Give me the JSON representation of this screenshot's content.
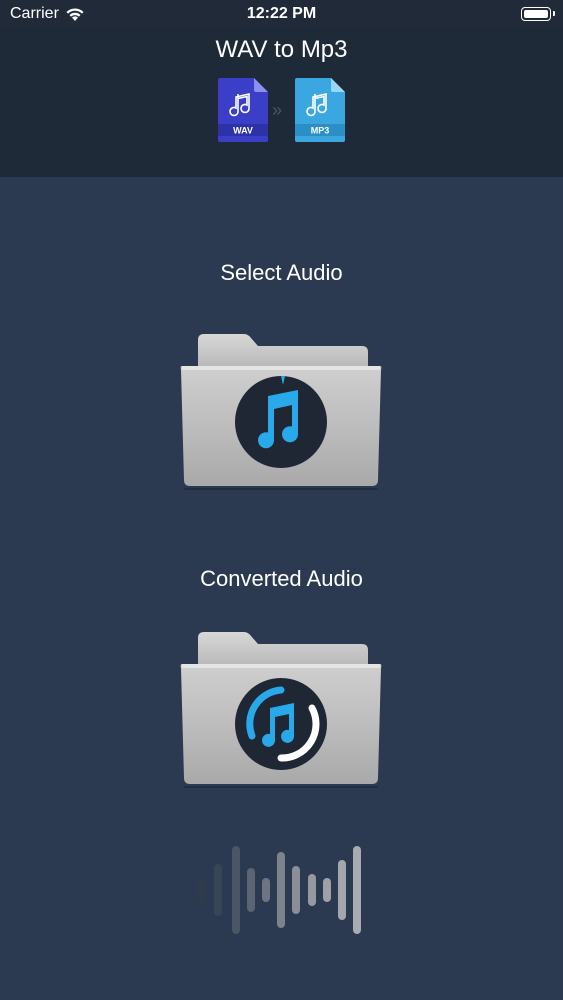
{
  "status_bar": {
    "carrier": "Carrier",
    "time": "12:22 PM"
  },
  "header": {
    "title": "WAV to Mp3",
    "source_format": "WAV",
    "target_format": "MP3"
  },
  "sections": {
    "select_audio": "Select Audio",
    "converted_audio": "Converted Audio"
  },
  "colors": {
    "background": "#2b3a50",
    "header": "#1f2a39",
    "wav_icon": "#3b3fc8",
    "mp3_icon": "#3aa7e0",
    "accent": "#2aa9ea"
  },
  "icons": {
    "wifi": "wifi-icon",
    "battery": "battery-icon",
    "wav_file": "wav-file-icon",
    "mp3_file": "mp3-file-icon",
    "arrow": "double-chevron-right-icon",
    "select_folder": "music-folder-icon",
    "converted_folder": "converted-music-folder-icon",
    "waveform": "waveform-icon"
  }
}
